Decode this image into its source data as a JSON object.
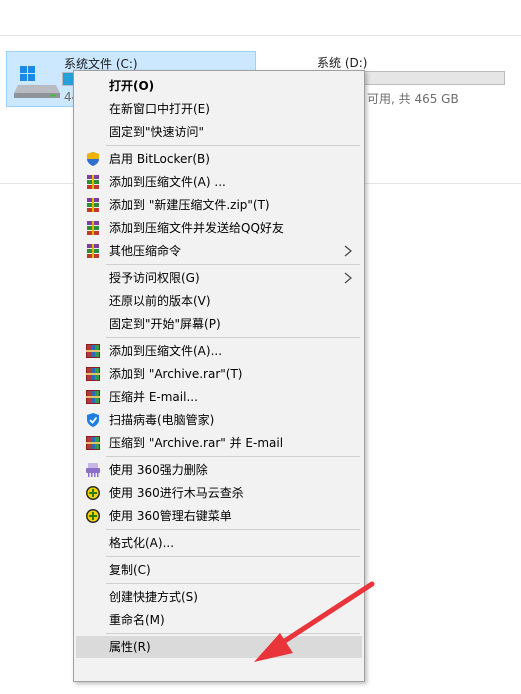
{
  "drives": {
    "c": {
      "name": "系统文件 (C:)",
      "free_text": "44",
      "used_fraction": 0.1
    },
    "d": {
      "name": "系统 (D:)",
      "free_text": "可用, 共 465 GB",
      "used_fraction": 0.12
    }
  },
  "menu": {
    "items": [
      {
        "label": "打开(O)",
        "icon": "none",
        "bold": true
      },
      {
        "label": "在新窗口中打开(E)",
        "icon": "none"
      },
      {
        "label": "固定到\"快速访问\"",
        "icon": "none"
      },
      {
        "label": "启用 BitLocker(B)",
        "icon": "shield-icon"
      },
      {
        "label": "添加到压缩文件(A) ...",
        "icon": "winrar-stack-icon"
      },
      {
        "label": "添加到 \"新建压缩文件.zip\"(T)",
        "icon": "winrar-stack-icon"
      },
      {
        "label": "添加到压缩文件并发送给QQ好友",
        "icon": "winrar-stack-icon"
      },
      {
        "label": "其他压缩命令",
        "icon": "winrar-stack-icon",
        "submenu": true
      },
      {
        "label": "授予访问权限(G)",
        "icon": "none",
        "submenu": true
      },
      {
        "label": "还原以前的版本(V)",
        "icon": "none"
      },
      {
        "label": "固定到\"开始\"屏幕(P)",
        "icon": "none"
      },
      {
        "label": "添加到压缩文件(A)...",
        "icon": "winrar-books-icon"
      },
      {
        "label": "添加到 \"Archive.rar\"(T)",
        "icon": "winrar-books-icon"
      },
      {
        "label": "压缩并 E-mail...",
        "icon": "winrar-books-icon"
      },
      {
        "label": "扫描病毒(电脑管家)",
        "icon": "tencent-shield-icon"
      },
      {
        "label": "压缩到 \"Archive.rar\" 并 E-mail",
        "icon": "winrar-books-icon"
      },
      {
        "label": "使用 360强力删除",
        "icon": "shredder-icon"
      },
      {
        "label": "使用 360进行木马云查杀",
        "icon": "360-icon"
      },
      {
        "label": "使用 360管理右键菜单",
        "icon": "360-icon"
      },
      {
        "label": "格式化(A)...",
        "icon": "none"
      },
      {
        "label": "复制(C)",
        "icon": "none"
      },
      {
        "label": "创建快捷方式(S)",
        "icon": "none"
      },
      {
        "label": "重命名(M)",
        "icon": "none"
      },
      {
        "label": "属性(R)",
        "icon": "none",
        "highlighted": true
      }
    ]
  },
  "colors": {
    "accent_red": "#e8343a",
    "selection_blue": "#cce8ff",
    "drive_bar_fill": "#26a0da",
    "menu_bg": "#f2f2f2",
    "menu_highlight": "#dadada"
  }
}
